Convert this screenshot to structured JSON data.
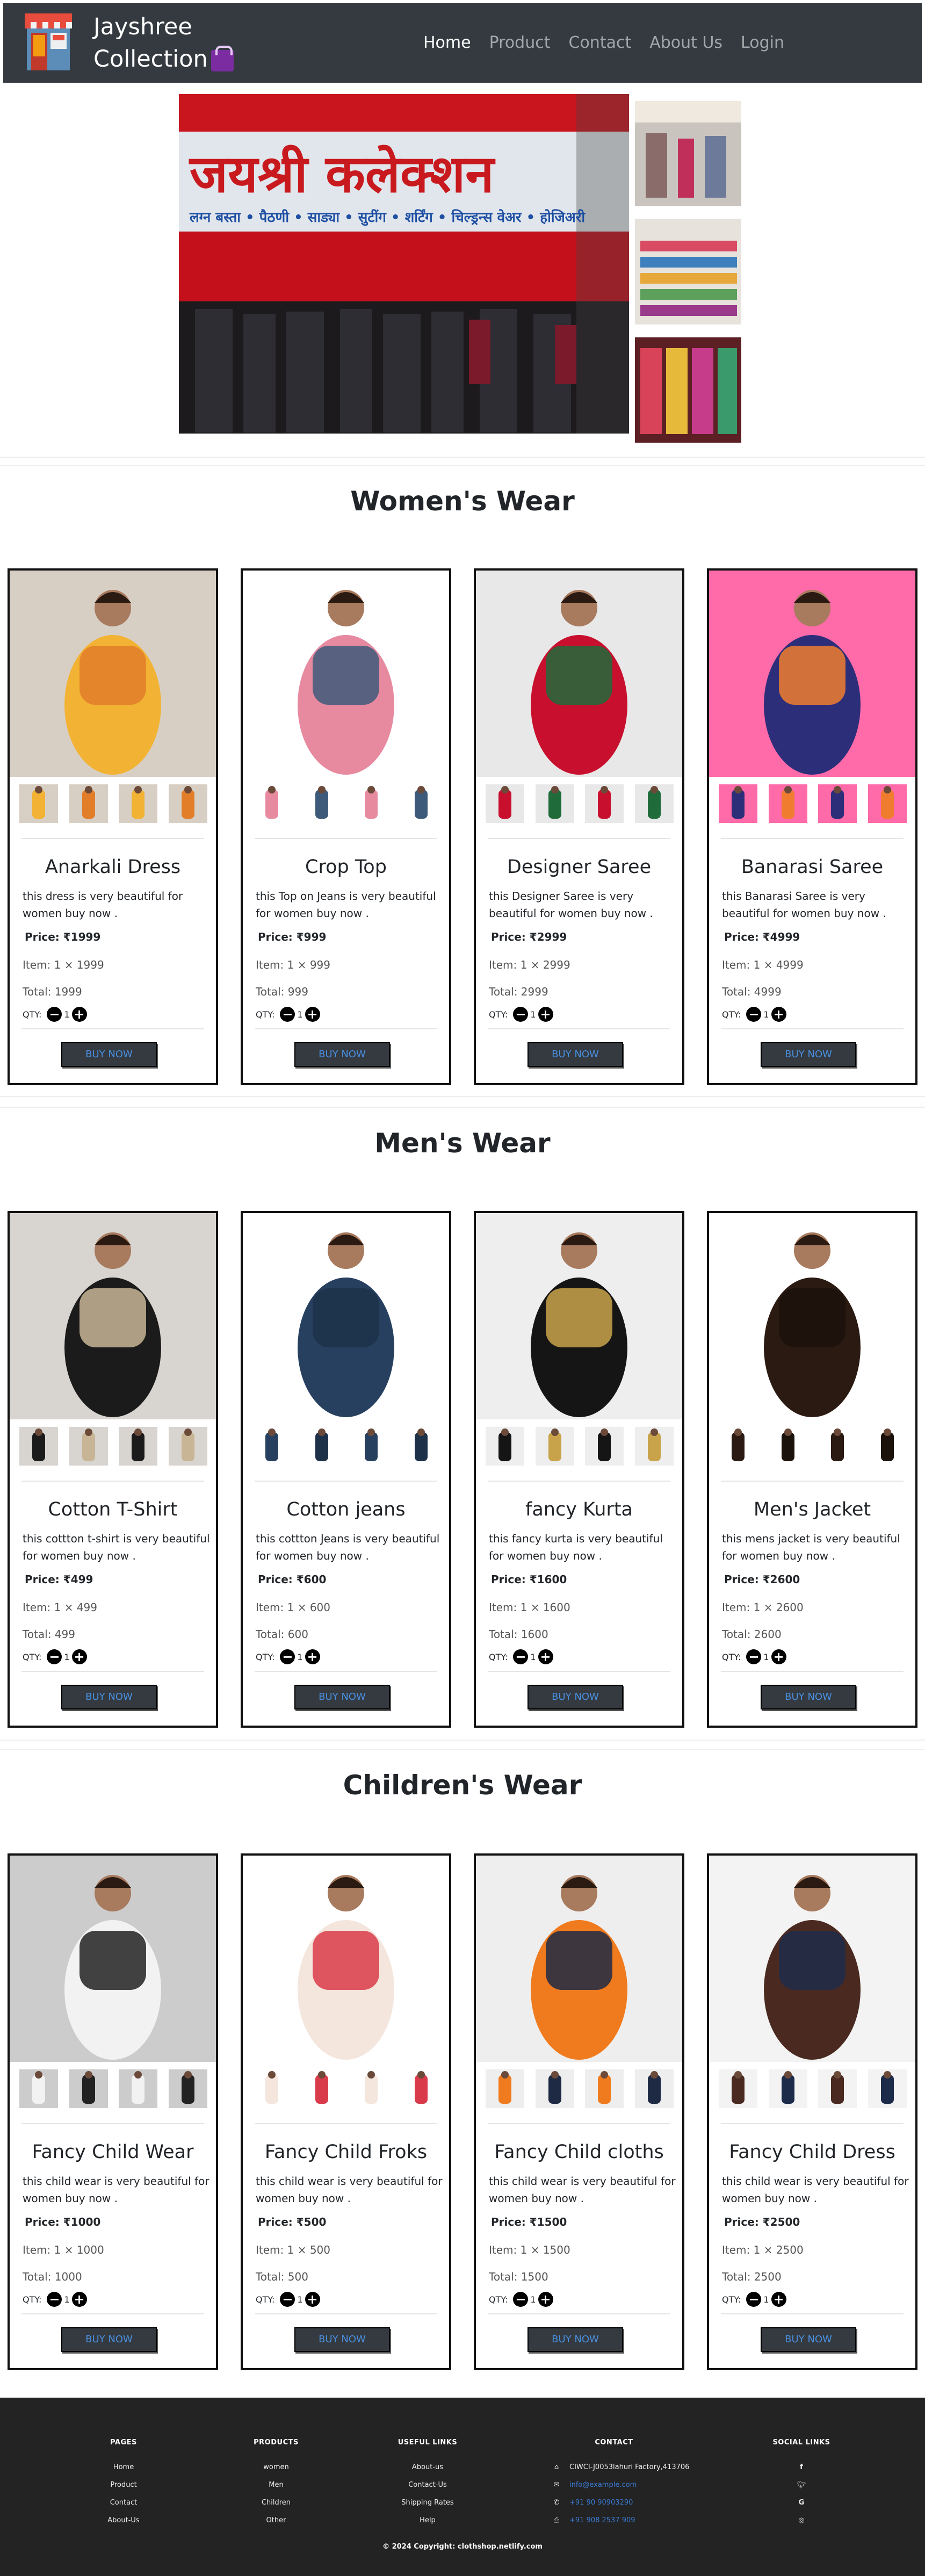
{
  "navbar": {
    "brand_line1": "Jayshree",
    "brand_line2": "Collection",
    "links": [
      "Home",
      "Product",
      "Contact",
      "About Us",
      "Login"
    ]
  },
  "hero": {
    "sign_line1": "जयश्री कलेक्शन",
    "sign_line2": "लग्न बस्ता • पैठणी • साड्या • सुटींग • शर्टिंग • चिल्ड्रन्स वेअर • होजिअरी"
  },
  "sections": [
    {
      "title": "Women's Wear",
      "products": [
        {
          "name": "Anarkali Dress",
          "desc": "this dress is very beautiful for women buy now .",
          "price": "Price: ₹1999",
          "item": "Item: 1 × 1999",
          "total": "Total: 1999",
          "qty": "1"
        },
        {
          "name": "Crop Top",
          "desc": "this Top on Jeans is very beautiful for women buy now .",
          "price": "Price: ₹999",
          "item": "Item: 1 × 999",
          "total": "Total: 999",
          "qty": "1"
        },
        {
          "name": "Designer Saree",
          "desc": "this Designer Saree is very beautiful for women buy now .",
          "price": "Price: ₹2999",
          "item": "Item: 1 × 2999",
          "total": "Total: 2999",
          "qty": "1"
        },
        {
          "name": "Banarasi Saree",
          "desc": "this Banarasi Saree is very beautiful for women buy now .",
          "price": "Price: ₹4999",
          "item": "Item: 1 × 4999",
          "total": "Total: 4999",
          "qty": "1"
        }
      ]
    },
    {
      "title": "Men's Wear",
      "products": [
        {
          "name": "Cotton T-Shirt",
          "desc": "this cottton t-shirt is very beautiful for women buy now .",
          "price": "Price: ₹499",
          "item": "Item: 1 × 499",
          "total": "Total: 499",
          "qty": "1"
        },
        {
          "name": "Cotton jeans",
          "desc": "this cottton Jeans is very beautiful for women buy now .",
          "price": "Price: ₹600",
          "item": "Item: 1 × 600",
          "total": "Total: 600",
          "qty": "1"
        },
        {
          "name": "fancy Kurta",
          "desc": "this fancy kurta is very beautiful for women buy now .",
          "price": "Price: ₹1600",
          "item": "Item: 1 × 1600",
          "total": "Total: 1600",
          "qty": "1"
        },
        {
          "name": "Men's Jacket",
          "desc": "this mens jacket is very beautiful for women buy now .",
          "price": "Price: ₹2600",
          "item": "Item: 1 × 2600",
          "total": "Total: 2600",
          "qty": "1"
        }
      ]
    },
    {
      "title": "Children's Wear",
      "products": [
        {
          "name": "Fancy Child Wear",
          "desc": "this child wear is very beautiful for women buy now .",
          "price": "Price: ₹1000",
          "item": "Item: 1 × 1000",
          "total": "Total: 1000",
          "qty": "1"
        },
        {
          "name": "Fancy Child Froks",
          "desc": "this child wear is very beautiful for women buy now .",
          "price": "Price: ₹500",
          "item": "Item: 1 × 500",
          "total": "Total: 500",
          "qty": "1"
        },
        {
          "name": "Fancy Child cloths",
          "desc": "this child wear is very beautiful for women buy now .",
          "price": "Price: ₹1500",
          "item": "Item: 1 × 1500",
          "total": "Total: 1500",
          "qty": "1"
        },
        {
          "name": "Fancy Child Dress",
          "desc": "this child wear is very beautiful for women buy now .",
          "price": "Price: ₹2500",
          "item": "Item: 1 × 2500",
          "total": "Total: 2500",
          "qty": "1"
        }
      ]
    }
  ],
  "card_common": {
    "qty_label": "QTY:",
    "minus": "−",
    "plus": "+",
    "buy_label": "BUY NOW"
  },
  "footer": {
    "pages": {
      "heading": "PAGES",
      "items": [
        "Home",
        "Product",
        "Contact",
        "About-Us"
      ]
    },
    "products": {
      "heading": "PRODUCTS",
      "items": [
        "women",
        "Men",
        "Children",
        "Other"
      ]
    },
    "useful": {
      "heading": "USEFUL LINKS",
      "items": [
        "About-us",
        "Contact-Us",
        "Shipping Rates",
        "Help"
      ]
    },
    "contact": {
      "heading": "CONTACT",
      "address": "CIWCI-J0053lahuri Factory,413706",
      "email": "info@example.com",
      "phone": "+91 90 90903290",
      "fax": "+91 908 2537 909"
    },
    "social": {
      "heading": "SOCIAL LINKS",
      "icons": [
        "facebook-icon",
        "twitter-icon",
        "google-icon",
        "instagram-icon"
      ]
    },
    "copyright": "© 2024 Copyright: clothshop.netlify.com"
  }
}
